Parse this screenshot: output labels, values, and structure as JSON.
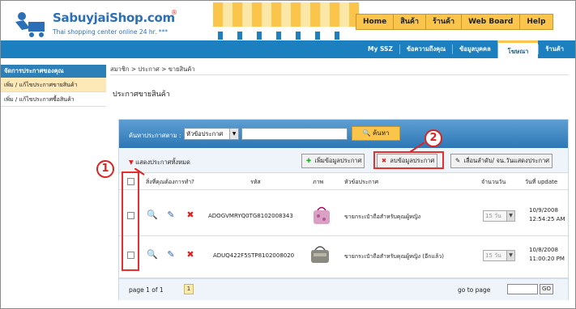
{
  "brand": {
    "name": "SabuyjaiShop.com",
    "reg": "®",
    "tagline": "Thai shopping center online 24 hr. ***"
  },
  "top_nav": [
    "Home",
    "สินค้า",
    "ร้านค้า",
    "Web Board",
    "Help"
  ],
  "sub_nav": [
    "My SSZ",
    "ข้อความถึงคุณ",
    "ข้อมูลบุคคล",
    "โฆษณา",
    "ร้านค้า"
  ],
  "sidebar": {
    "heading": "จัดการประกาศของคุณ",
    "items": [
      {
        "label": "เพิ่ม / แก้ไขประกาศขายสินค้า"
      },
      {
        "label": "เพิ่ม / แก้ไขประกาศซื้อสินค้า"
      }
    ]
  },
  "breadcrumb": "สมาชิก > ประกาศ > ขายสินค้า",
  "page_title": "ประกาศขายสินค้า",
  "search": {
    "label": "ค้นหาประกาศตาม :",
    "field_value": "หัวข้อประกาศ",
    "button": "ค้นหา"
  },
  "toolbar": {
    "show_all": "แสดงประกาศทั้งหมด",
    "add": "เพิ่มข้อมูลประกาศ",
    "delete": "ลบข้อมูลประกาศ",
    "reorder": "เลื่อนลำดับ/ จน.วันแสดงประกาศ"
  },
  "columns": {
    "action": "สิ่งที่คุณต้องการทำ?",
    "code": "รหัส",
    "image": "ภาพ",
    "topic": "หัวข้อประกาศ",
    "days": "จำนวนวัน",
    "updated": "วันที่ update"
  },
  "rows": [
    {
      "code": "ADOGVMRYQ0TG8102008343",
      "topic": "ขายกระเป๋าถือสำหรับคุณผู้หญิง",
      "days": "15 วัน",
      "date": "10/9/2008",
      "time": "12:54:25 AM"
    },
    {
      "code": "ADUQ422F5STP8102008020",
      "topic": "ขายกระเป๋าถือสำหรับคุณผู้หญิง (อีกแล้ว)",
      "days": "15 วัน",
      "date": "10/8/2008",
      "time": "11:00:20 PM"
    }
  ],
  "pagination": {
    "info": "page 1 of 1",
    "current": "1",
    "goto_label": "go to page",
    "goto_button": "GO"
  },
  "callouts": [
    "1",
    "2"
  ],
  "colors": {
    "brand_blue": "#1c7fbf",
    "accent_yellow": "#fbc44a",
    "highlight_red": "#e53030"
  }
}
